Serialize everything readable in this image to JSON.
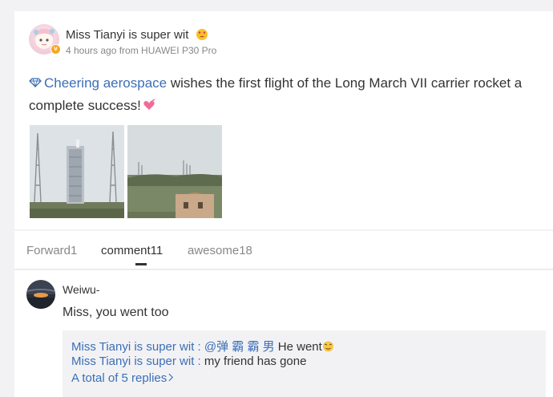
{
  "post": {
    "username": "Miss Tianyi is super wit",
    "meta": "4 hours ago from HUAWEI P30 Pro",
    "topic": "Cheering aerospace",
    "text": " wishes the first flight of the Long March VII carrier rocket a complete success!",
    "verified_badge": "v",
    "icons": {
      "verified": "verified-badge-icon",
      "username_emoji": "heart-eyes-emoji-icon",
      "topic": "diamond-topic-icon",
      "text_emoji": "heart-emoji-icon"
    },
    "colors": {
      "link": "#3b6fb6",
      "badge": "#f7a91c"
    }
  },
  "tabs": [
    {
      "label": "Forward1"
    },
    {
      "label": "comment11"
    },
    {
      "label": "awesome18"
    }
  ],
  "comment": {
    "name": "Weiwu-",
    "text": "Miss, you went too",
    "replies": [
      {
        "author": "Miss Tianyi is super wit",
        "separator": " : ",
        "mention": "@弹 霸 霸 男",
        "text": " He went"
      },
      {
        "author": "Miss Tianyi is super wit",
        "separator": " : ",
        "text": "my friend has gone"
      }
    ],
    "more": "A total of 5 replies"
  }
}
